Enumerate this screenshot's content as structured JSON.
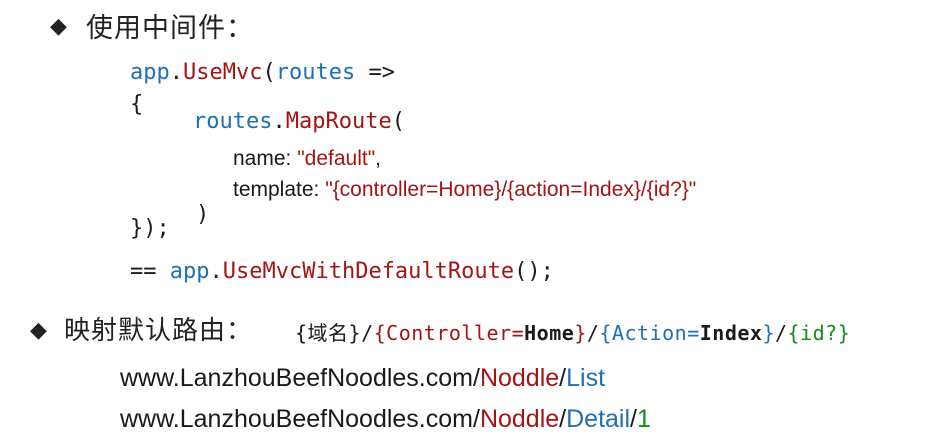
{
  "section1": {
    "bullet": "◆",
    "title": "使用中间件："
  },
  "code": {
    "line1": {
      "obj": "app",
      "dot": ".",
      "method": "UseMvc",
      "paren": "(",
      "arg": "routes",
      "arrow": " =>"
    },
    "open_brace": "{",
    "line3": {
      "obj": "routes",
      "dot": ".",
      "method": "MapRoute",
      "paren": "("
    },
    "name_param": {
      "key": "name: ",
      "value": "\"default\"",
      "comma": ","
    },
    "template_param": {
      "key": "template: ",
      "value": "\"{controller=Home}/{action=Index}/{id?}\""
    },
    "close_paren": ")",
    "close_block": "});",
    "line_default": {
      "prefix": "== ",
      "obj": "app",
      "dot": ".",
      "method": "UseMvcWithDefaultRoute",
      "end": "();"
    }
  },
  "section2": {
    "bullet": "◆",
    "title": "映射默认路由：",
    "pattern": {
      "domain": "{域名}",
      "s1": "/",
      "controller_open": "{Controller=",
      "controller_val": "Home",
      "controller_close": "}",
      "s2": "/",
      "action_open": "{Action=",
      "action_val": "Index",
      "action_close": "}",
      "s3": "/",
      "id": "{id?}"
    }
  },
  "urls": [
    {
      "host": "www.LanzhouBeefNoodles.com/",
      "controller": "Noddle",
      "sep": "/",
      "action": "List"
    },
    {
      "host": "www.LanzhouBeefNoodles.com/",
      "controller": "Noddle",
      "sep": "/",
      "action": "Detail",
      "sep2": "/",
      "id": "1"
    }
  ],
  "colors": {
    "blue": "#1f6fb2",
    "red": "#a31515",
    "green": "#108c1e"
  }
}
